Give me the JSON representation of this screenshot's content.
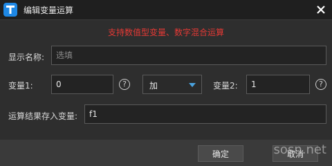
{
  "window": {
    "title": "编辑变量运算",
    "icon": "app-t-icon"
  },
  "hint": "支持数值型变量、数字混合运算",
  "fields": {
    "display_name": {
      "label": "显示名称:",
      "value": "",
      "placeholder": "选填"
    },
    "var1": {
      "label": "变量1:",
      "value": "0"
    },
    "operator": {
      "value": "加"
    },
    "var2": {
      "label": "变量2:",
      "value": "1"
    },
    "result": {
      "label": "运算结果存入变量:",
      "value": "f1"
    }
  },
  "help_glyph": "?",
  "buttons": {
    "ok": "确定",
    "cancel": "取消"
  },
  "watermark": "sosn.net",
  "colors": {
    "hint": "#e53935",
    "accent": "#1e88e5",
    "caret": "#4aa3df"
  }
}
